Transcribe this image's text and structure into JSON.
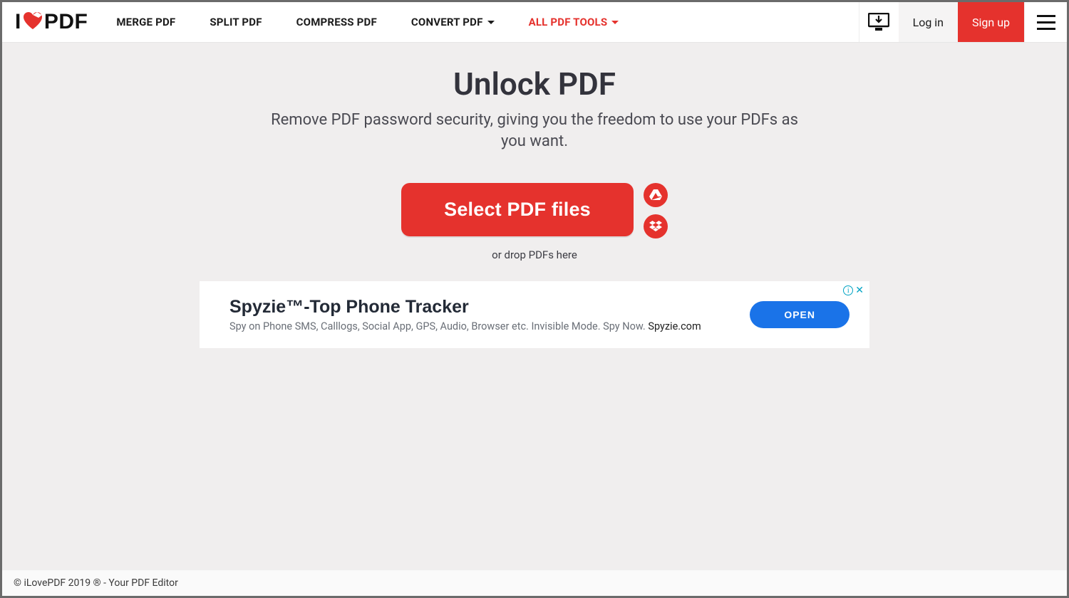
{
  "logo": {
    "prefix": "I",
    "suffix": "PDF"
  },
  "nav": {
    "merge": "MERGE PDF",
    "split": "SPLIT PDF",
    "compress": "COMPRESS PDF",
    "convert": "CONVERT PDF",
    "all_tools": "ALL PDF TOOLS"
  },
  "auth": {
    "login": "Log in",
    "signup": "Sign up"
  },
  "hero": {
    "title": "Unlock PDF",
    "subtitle": "Remove PDF password security, giving you the freedom to use your PDFs as you want."
  },
  "picker": {
    "select_label": "Select PDF files",
    "drop_hint": "or drop PDFs here",
    "gdrive_icon": "google-drive-icon",
    "dropbox_icon": "dropbox-icon"
  },
  "ad": {
    "title": "Spyzie™-Top Phone Tracker",
    "desc": "Spy on Phone SMS, Calllogs, Social App, GPS, Audio, Browser etc. Invisible Mode. Spy Now. ",
    "domain": "Spyzie.com",
    "cta": "OPEN"
  },
  "footer": {
    "text": "© iLovePDF 2019 ® - Your PDF Editor"
  },
  "colors": {
    "accent": "#e5322d",
    "ad_button": "#1a73e8"
  }
}
